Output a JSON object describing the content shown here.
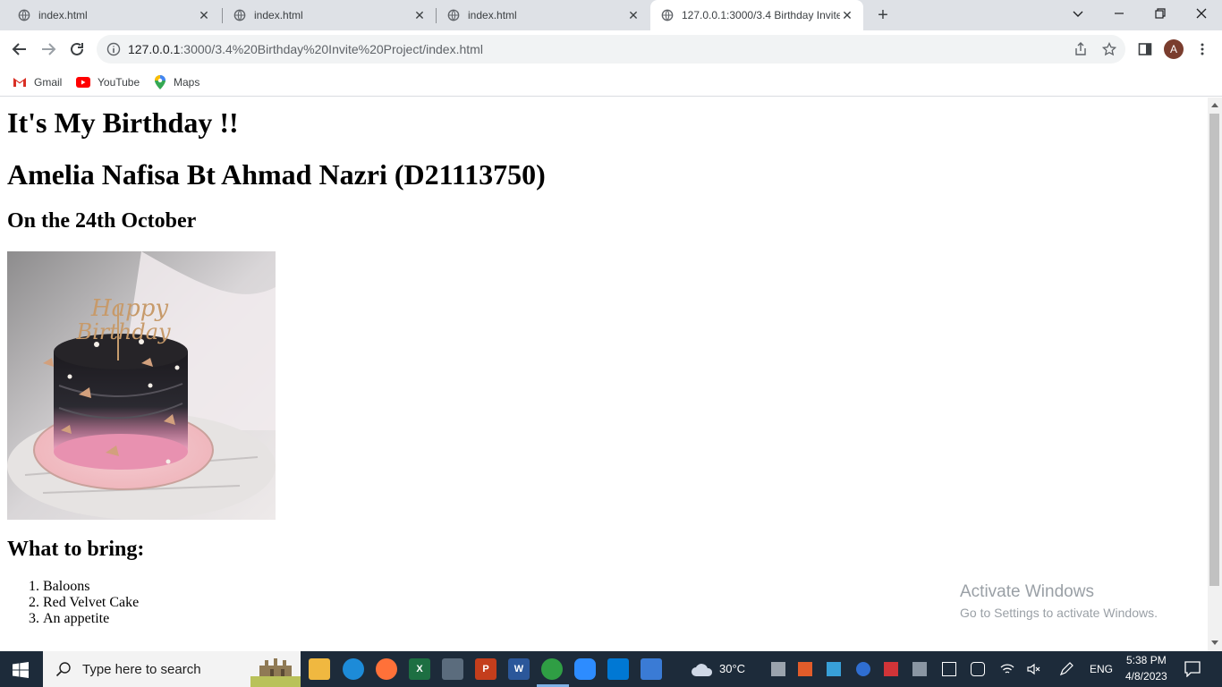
{
  "browser": {
    "tabs": [
      {
        "label": "index.html",
        "active": false
      },
      {
        "label": "index.html",
        "active": false
      },
      {
        "label": "index.html",
        "active": false
      },
      {
        "label": "127.0.0.1:3000/3.4 Birthday Invite",
        "active": true
      }
    ],
    "url_host": "127.0.0.1",
    "url_rest": ":3000/3.4%20Birthday%20Invite%20Project/index.html",
    "avatar_letter": "A",
    "bookmarks": [
      {
        "label": "Gmail",
        "icon": "gmail-icon"
      },
      {
        "label": "YouTube",
        "icon": "youtube-icon"
      },
      {
        "label": "Maps",
        "icon": "maps-icon"
      }
    ]
  },
  "page": {
    "title": "It's My Birthday !!",
    "name": "Amelia Nafisa Bt Ahmad Nazri (D21113750)",
    "date": "On the 24th October",
    "cake_text_line1": "Happy",
    "cake_text_line2": "Birthday",
    "bring_heading": "What to bring:",
    "bring_items": [
      "Baloons",
      "Red Velvet Cake",
      "An appetite"
    ]
  },
  "watermark": {
    "line1": "Activate Windows",
    "line2": "Go to Settings to activate Windows."
  },
  "taskbar": {
    "search_placeholder": "Type here to search",
    "weather": "30°C",
    "lang": "ENG",
    "time": "5:38 PM",
    "date": "4/8/2023",
    "colors": {
      "bg": "#1d2b3a",
      "excel": "#1d6f42",
      "powerpoint": "#c43e1c",
      "word": "#2b579a",
      "vscode": "#0078d4"
    }
  }
}
